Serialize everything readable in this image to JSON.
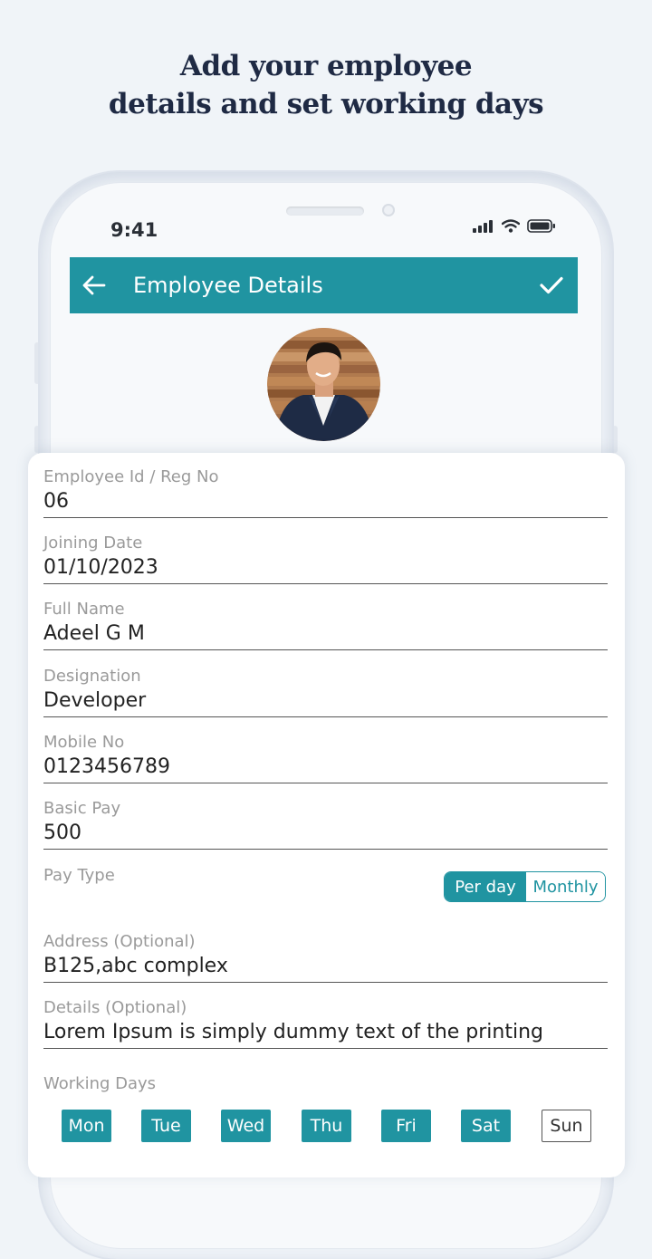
{
  "headline": {
    "line1": "Add your employee",
    "line2": "details and set working days"
  },
  "status_bar": {
    "time": "9:41",
    "icons": [
      "signal-icon",
      "wifi-icon",
      "battery-icon"
    ]
  },
  "app_bar": {
    "title": "Employee Details",
    "back_icon": "back-arrow-icon",
    "confirm_icon": "check-icon"
  },
  "form": {
    "employee_id": {
      "label": "Employee Id / Reg No",
      "value": "06"
    },
    "joining_date": {
      "label": "Joining Date",
      "value": "01/10/2023"
    },
    "full_name": {
      "label": "Full Name",
      "value": "Adeel G M"
    },
    "designation": {
      "label": "Designation",
      "value": "Developer"
    },
    "mobile": {
      "label": "Mobile No",
      "value": "0123456789"
    },
    "basic_pay": {
      "label": "Basic Pay",
      "value": "500"
    },
    "pay_type": {
      "label": "Pay Type",
      "options": [
        "Per day",
        "Monthly"
      ],
      "selected": "Per day"
    },
    "address": {
      "label": "Address (Optional)",
      "value": "B125,abc complex"
    },
    "details": {
      "label": "Details (Optional)",
      "value": "Lorem Ipsum is simply dummy text of the printing"
    },
    "working_days": {
      "label": "Working Days",
      "days": [
        {
          "label": "Mon",
          "selected": true
        },
        {
          "label": "Tue",
          "selected": true
        },
        {
          "label": "Wed",
          "selected": true
        },
        {
          "label": "Thu",
          "selected": true
        },
        {
          "label": "Fri",
          "selected": true
        },
        {
          "label": "Sat",
          "selected": true
        },
        {
          "label": "Sun",
          "selected": false
        }
      ]
    }
  },
  "colors": {
    "accent": "#2094a1",
    "background": "#f0f4f8",
    "headline": "#1f2a44"
  }
}
